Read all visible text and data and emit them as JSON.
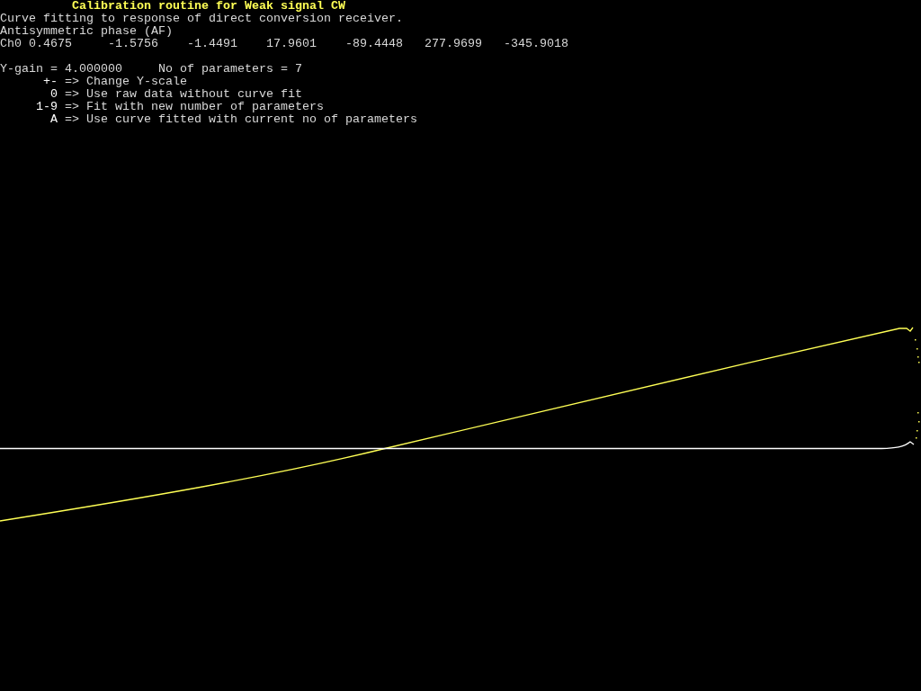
{
  "title": "Calibration routine for Weak signal CW",
  "description": "Curve fitting to response of direct conversion receiver.",
  "mode": "Antisymmetric phase (AF)",
  "coefficients": {
    "label": "Ch0",
    "values": [
      "0.4675",
      "-1.5756",
      "-1.4491",
      "17.9601",
      "-89.4448",
      "277.9699",
      "-345.9018"
    ]
  },
  "status": {
    "y_gain": "Y-gain = 4.000000",
    "parameters": "No of parameters = 7"
  },
  "menu": [
    {
      "key": "+-",
      "arrow": "=>",
      "action": "Change Y-scale"
    },
    {
      "key": "0",
      "arrow": "=>",
      "action": "Use raw data without curve fit"
    },
    {
      "key": "1-9",
      "arrow": "=>",
      "action": "Fit with new number of parameters"
    },
    {
      "key": "A",
      "arrow": "=>",
      "action": "Use curve fitted with current no of parameters"
    }
  ]
}
